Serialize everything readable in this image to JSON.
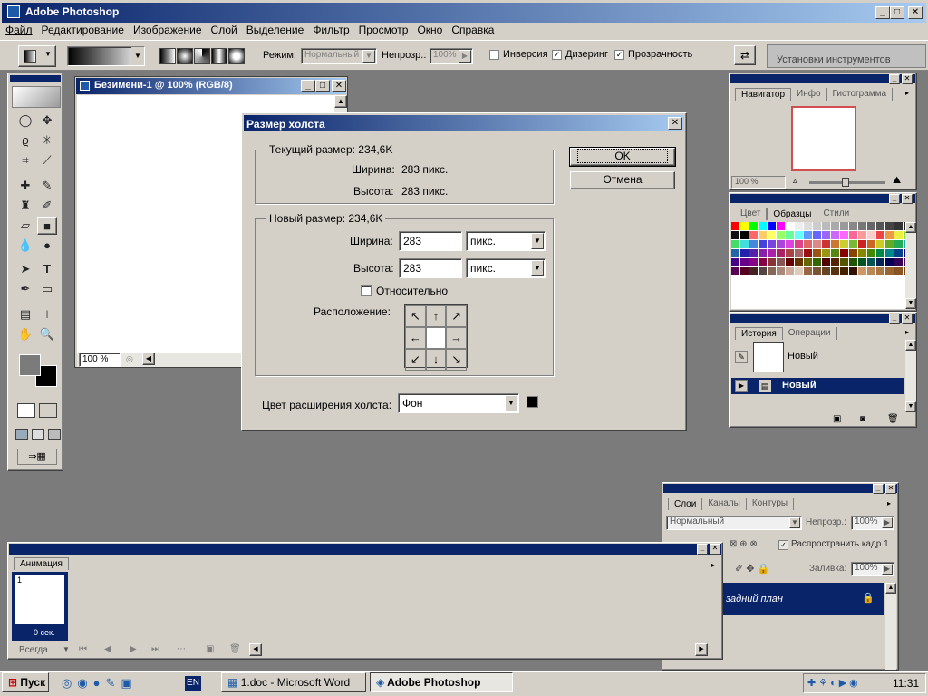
{
  "app": {
    "title": "Adobe Photoshop"
  },
  "menu": [
    "Файл",
    "Редактирование",
    "Изображение",
    "Слой",
    "Выделение",
    "Фильтр",
    "Просмотр",
    "Окно",
    "Справка"
  ],
  "options": {
    "mode_label": "Режим:",
    "mode_value": "Нормальный",
    "opacity_label": "Непрозр.:",
    "opacity_value": "100%",
    "inverse": "Инверсия",
    "dither": "Дизеринг",
    "transparency": "Прозрачность",
    "presets": "Установки инструментов"
  },
  "doc": {
    "title": "Безимени-1 @ 100% (RGB/8)",
    "zoom": "100 %"
  },
  "dialog": {
    "title": "Размер холста",
    "current_title": "Текущий размер: 234,6K",
    "current_width_label": "Ширина:",
    "current_width": "283 пикс.",
    "current_height_label": "Высота:",
    "current_height": "283 пикс.",
    "new_title": "Новый размер: 234,6K",
    "width_label": "Ширина:",
    "width_value": "283",
    "width_unit": "пикс.",
    "height_label": "Высота:",
    "height_value": "283",
    "height_unit": "пикс.",
    "relative": "Относительно",
    "anchor_label": "Расположение:",
    "ext_color_label": "Цвет расширения холста:",
    "ext_color_value": "Фон",
    "ok": "OK",
    "cancel": "Отмена"
  },
  "navigator": {
    "tabs": [
      "Навигатор",
      "Инфо",
      "Гистограмма"
    ],
    "zoom": "100 %"
  },
  "swatches": {
    "tabs": [
      "Цвет",
      "Образцы",
      "Стили"
    ]
  },
  "history": {
    "tabs": [
      "История",
      "Операции"
    ],
    "snapshot": "Новый",
    "step": "Новый"
  },
  "layers": {
    "tabs": [
      "Слои",
      "Каналы",
      "Контуры"
    ],
    "blend": "Нормальный",
    "opacity_label": "Непрозр.:",
    "opacity": "100%",
    "propagate": "Распространить кадр 1",
    "fill_label": "Заливка:",
    "fill": "100%",
    "layer_name": "задний план"
  },
  "animation": {
    "title": "Анимация",
    "frame_num": "1",
    "frame_time": "0 сек.",
    "loop": "Всегда"
  },
  "taskbar": {
    "start": "Пуск",
    "lang": "EN",
    "task1": "1.doc - Microsoft Word",
    "task2": "Adobe Photoshop",
    "clock": "11:31"
  },
  "colors": {
    "titlebar": "#0a246a",
    "titlebar_end": "#a6caf0",
    "face": "#d4d0c8",
    "workspace": "#7b7b7b"
  }
}
